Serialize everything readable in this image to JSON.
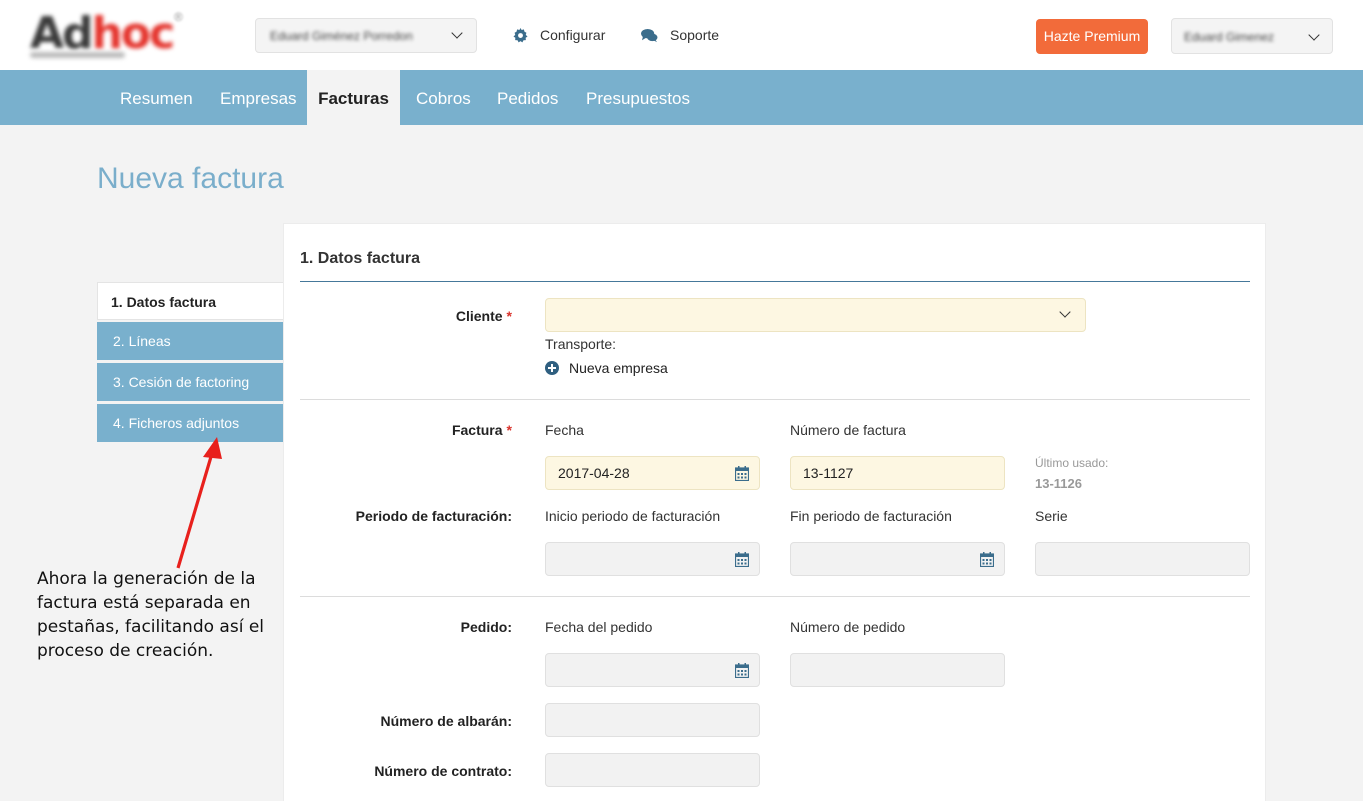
{
  "header": {
    "company_select": {
      "value": "Eduard Giménez Porredon"
    },
    "links": [
      {
        "label": "Configurar",
        "icon": "gear-icon"
      },
      {
        "label": "Soporte",
        "icon": "comments-icon"
      }
    ],
    "premium_label": "Hazte Premium",
    "user_select": {
      "value": "Eduard Gimenez"
    }
  },
  "nav": {
    "tabs": [
      {
        "label": "Resumen"
      },
      {
        "label": "Empresas"
      },
      {
        "label": "Facturas",
        "active": true
      },
      {
        "label": "Cobros"
      },
      {
        "label": "Pedidos"
      },
      {
        "label": "Presupuestos"
      }
    ]
  },
  "page": {
    "title": "Nueva factura"
  },
  "steps": [
    {
      "label": "1. Datos factura",
      "active": true
    },
    {
      "label": "2. Líneas"
    },
    {
      "label": "3. Cesión de factoring"
    },
    {
      "label": "4. Ficheros adjuntos"
    }
  ],
  "form": {
    "section_title": "1. Datos factura",
    "cliente": {
      "label": "Cliente",
      "required_mark": "*",
      "value": "",
      "transporte_label": "Transporte:",
      "new_company_label": "Nueva empresa"
    },
    "factura": {
      "label": "Factura",
      "required_mark": "*",
      "fecha_label": "Fecha",
      "fecha_value": "2017-04-28",
      "numero_label": "Número de factura",
      "numero_value": "13-1127",
      "last_used_label": "Último usado:",
      "last_used_value": "13-1126"
    },
    "periodo": {
      "label": "Periodo de facturación:",
      "inicio_label": "Inicio periodo de facturación",
      "fin_label": "Fin periodo de facturación",
      "serie_label": "Serie"
    },
    "pedido": {
      "label": "Pedido:",
      "fecha_label": "Fecha del pedido",
      "numero_label": "Número de pedido"
    },
    "albaran": {
      "label": "Número de albarán:"
    },
    "contrato": {
      "label": "Número de contrato:"
    }
  },
  "annotation": {
    "text": "Ahora la generación de la factura está separada en pestañas, facilitando así el proceso de creación.",
    "color": "#e8201c"
  },
  "colors": {
    "nav_bg": "#79b0cd",
    "title": "#7aaecb",
    "premium": "#f26b3a",
    "required_input_bg": "#fdf7e2"
  }
}
